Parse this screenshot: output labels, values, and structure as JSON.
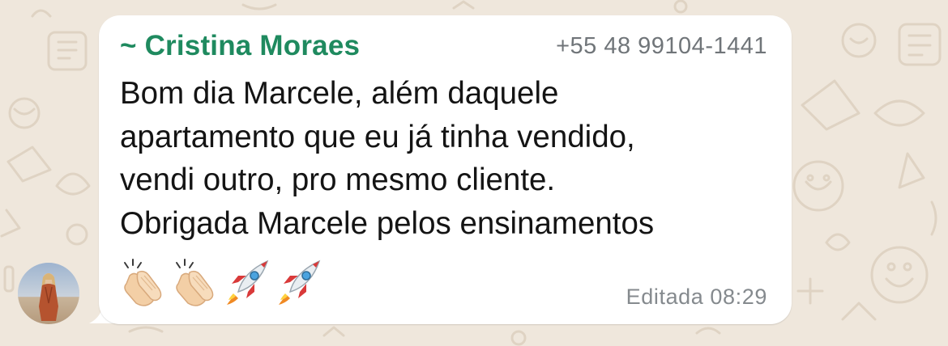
{
  "chat": {
    "wallpaper": "whatsapp-doodle-pattern",
    "background_color": "#efe7dc"
  },
  "message": {
    "sender_name": "~ Cristina Moraes",
    "sender_name_color": "#1f8a5f",
    "sender_phone": "+55 48 99104-1441",
    "body_lines": [
      "Bom dia Marcele, além daquele",
      "apartamento que eu já tinha vendido,",
      "vendi outro, pro mesmo cliente.",
      "Obrigada Marcele pelos ensinamentos"
    ],
    "emojis": [
      "clapping-hands",
      "clapping-hands",
      "rocket",
      "rocket"
    ],
    "edited_label": "Editada",
    "time": "08:29",
    "bubble_color": "#ffffff"
  },
  "avatar": {
    "icon": "user-avatar-photo"
  }
}
